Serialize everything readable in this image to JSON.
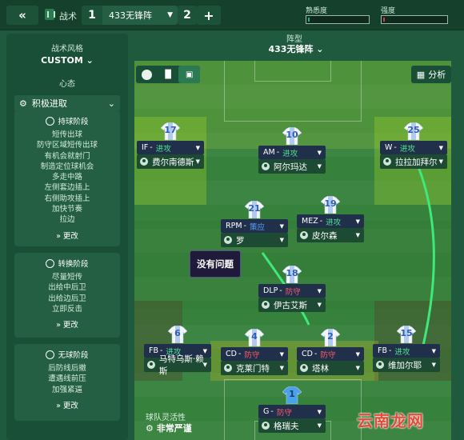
{
  "header": {
    "back_icon": "«",
    "tactic_icon": "tactic-icon",
    "tactic_label": "战术",
    "tab1_number": "1",
    "tab1_name": "433无锋阵",
    "tab2_number": "2",
    "add_tab": "+",
    "familiarity_label": "熟悉度",
    "intensity_label": "强度",
    "familiarity_level": 0.03,
    "intensity_level": 0.03,
    "familiarity_color": "#1fb38a",
    "intensity_color": "#e0394a"
  },
  "sidebar": {
    "style_label": "战术风格",
    "style_value": "CUSTOM",
    "mentality_label": "心态",
    "mentality_value": "积极进取",
    "in_possession": {
      "title": "持球阶段",
      "items": [
        "短传出球",
        "防守区域短传出球",
        "有机会就射门",
        "制造定位球机会",
        "多走中路",
        "左侧套边插上",
        "右侧助攻插上",
        "加快节奏",
        "拉边"
      ],
      "more": "更改"
    },
    "transition": {
      "title": "转换阶段",
      "items": [
        "尽量短传",
        "出给中后卫",
        "出给边后卫",
        "立即反击"
      ],
      "more": "更改"
    },
    "out_of_possession": {
      "title": "无球阶段",
      "items": [
        "后防线后撤",
        "遭遇线前压",
        "加强紧逼"
      ],
      "more": "更改"
    }
  },
  "pitch": {
    "formation_label": "阵型",
    "formation_value": "433无锋阵",
    "analysis_label": "分析",
    "flexibility_label": "球队灵活性",
    "flexibility_value": "非常严谨",
    "tooltip": "没有问题",
    "watermark": "云南龙网"
  },
  "players": [
    {
      "num": "17",
      "role": "IF",
      "duty": "进攻",
      "name": "费尔南德斯",
      "duty_color": "#4fe08a"
    },
    {
      "num": "10",
      "role": "AM",
      "duty": "进攻",
      "name": "阿尔玛达",
      "duty_color": "#4fe08a"
    },
    {
      "num": "25",
      "role": "W",
      "duty": "进攻",
      "name": "拉拉加拜尔",
      "duty_color": "#4fe08a"
    },
    {
      "num": "21",
      "role": "RPM",
      "duty": "策应",
      "name": "罗",
      "duty_color": "#5aa0ff"
    },
    {
      "num": "19",
      "role": "MEZ",
      "duty": "进攻",
      "name": "皮尔森",
      "duty_color": "#4fe08a"
    },
    {
      "num": "18",
      "role": "DLP",
      "duty": "防守",
      "name": "伊古艾斯",
      "duty_color": "#ff5a6a"
    },
    {
      "num": "6",
      "role": "FB",
      "duty": "进攻",
      "name": "马特乌斯·赖斯",
      "duty_color": "#4fe08a"
    },
    {
      "num": "4",
      "role": "CD",
      "duty": "防守",
      "name": "克莱门特",
      "duty_color": "#ff5a6a"
    },
    {
      "num": "2",
      "role": "CD",
      "duty": "防守",
      "name": "塔林",
      "duty_color": "#ff5a6a"
    },
    {
      "num": "15",
      "role": "FB",
      "duty": "进攻",
      "name": "维加尔耶",
      "duty_color": "#4fe08a"
    },
    {
      "num": "1",
      "role": "G",
      "duty": "防守",
      "name": "格瑞夫",
      "duty_color": "#ff5a6a"
    }
  ]
}
